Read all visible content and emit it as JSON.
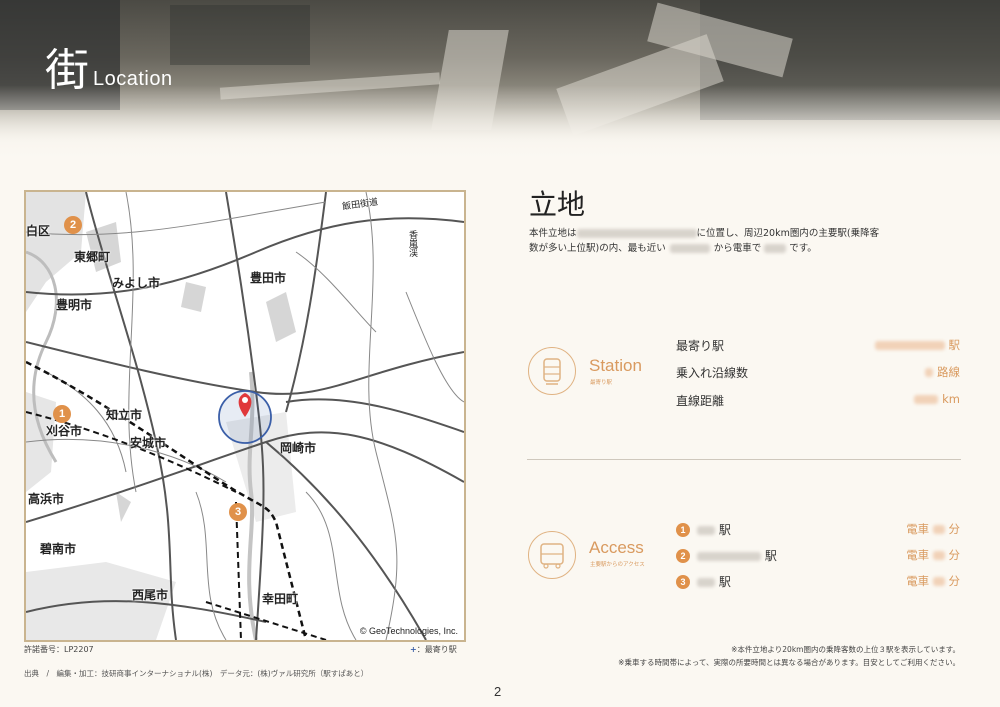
{
  "header": {
    "kanji": "街",
    "english": "Location"
  },
  "map": {
    "labels": {
      "shiroku": "白区",
      "higashigo": "東郷町",
      "miyoshi": "みよし市",
      "toyoake": "豊明市",
      "toyota": "豊田市",
      "chiryu": "知立市",
      "kariya": "刈谷市",
      "anjo": "安城市",
      "okazaki": "岡崎市",
      "takahama": "高浜市",
      "hekinan": "碧南市",
      "nishio": "西尾市",
      "kota": "幸田町",
      "iida_kaido": "飯田街道",
      "korankei": "香嵐渓"
    },
    "badges": [
      "2",
      "1",
      "3"
    ],
    "copyright": "© GeoTechnologies, Inc."
  },
  "permit": "許諾番号：LP2207",
  "legend": {
    "symbol": "+",
    "label": "：最寄り駅"
  },
  "source": "出典　/　編集・加工：技研商事インターナショナル(株)　データ元：(株)ヴァル研究所（駅すぱあと）",
  "page_number": "2",
  "title": "立地",
  "description": {
    "p1": "本件立地は",
    "p2": "に位置し、周辺20km圏内の主要駅(乗降客",
    "p3": "数が多い上位駅)の内、最も近い",
    "p4": "から電車で",
    "p5": "です。"
  },
  "station": {
    "name": "Station",
    "sub": "最寄り駅",
    "rows": [
      {
        "label": "最寄り駅",
        "suffix": "駅"
      },
      {
        "label": "乗入れ沿線数",
        "suffix": "路線"
      },
      {
        "label": "直線距離",
        "suffix": "km"
      }
    ]
  },
  "access": {
    "name": "Access",
    "sub": "主要駅からのアクセス",
    "rows": [
      {
        "num": "1",
        "suffix": "駅",
        "mode": "電車",
        "unit": "分"
      },
      {
        "num": "2",
        "suffix": "駅",
        "mode": "電車",
        "unit": "分"
      },
      {
        "num": "3",
        "suffix": "駅",
        "mode": "電車",
        "unit": "分"
      }
    ]
  },
  "notes": {
    "n1": "※本件立地より20km圏内の乗降客数の上位３駅を表示しています。",
    "n2": "※乗車する時間帯によって、実際の所要時間とは異なる場合があります。目安としてご利用ください。"
  },
  "colors": {
    "accent": "#d99a5f",
    "badge": "#e0914a",
    "pin": "#e0383b",
    "circle": "#3b5fa8"
  }
}
